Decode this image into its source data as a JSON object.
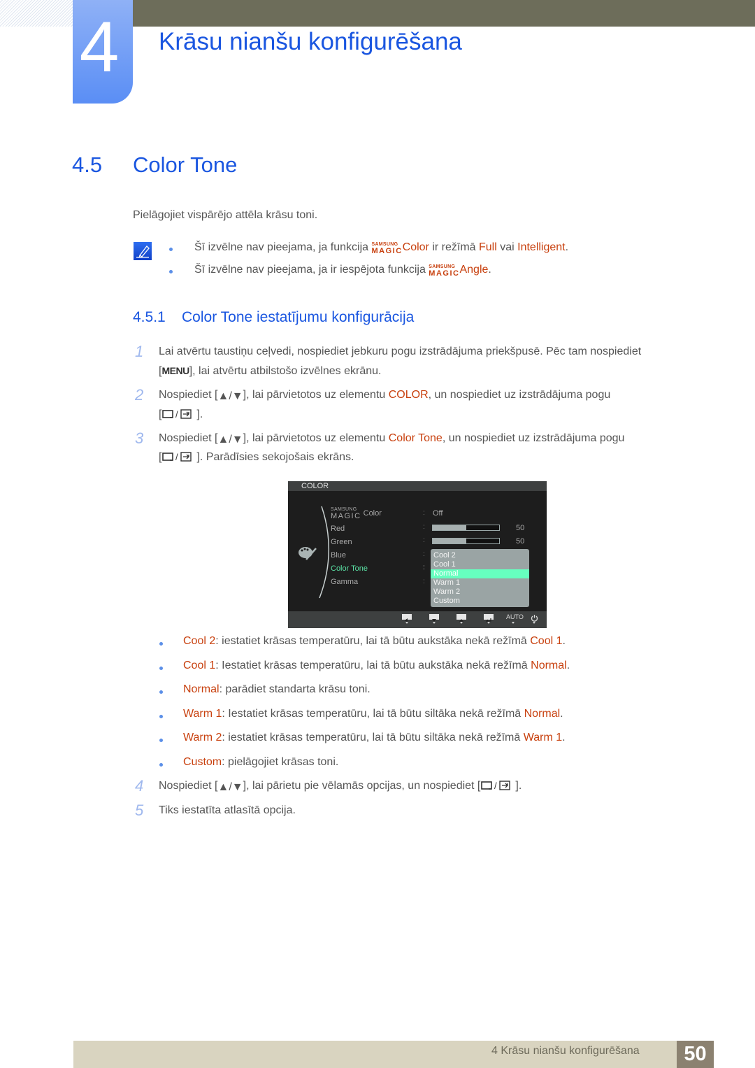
{
  "header": {
    "chapter_number": "4",
    "chapter_title": "Krāsu nianšu konfigurēšana"
  },
  "section": {
    "number": "4.5",
    "title": "Color Tone",
    "intro": "Pielāgojiet vispārējo attēla krāsu toni."
  },
  "notes": {
    "icon": "note-pencil-icon",
    "items": [
      {
        "pre": "Šī izvēlne nav pieejama, ja funkcija ",
        "magic_top": "SAMSUNG",
        "magic_bottom": "MAGIC",
        "magic_word": "Color",
        "mid": " ir režīmā ",
        "hl1": "Full",
        "mid2": " vai ",
        "hl2": "Intelligent",
        "post": "."
      },
      {
        "pre": "Šī izvēlne nav pieejama, ja ir iespējota funkcija ",
        "magic_top": "SAMSUNG",
        "magic_bottom": "MAGIC",
        "magic_word": "Angle",
        "post": "."
      }
    ]
  },
  "subsection": {
    "number": "4.5.1",
    "title": "Color Tone iestatījumu konfigurācija"
  },
  "steps": [
    {
      "num": "1",
      "line1": "Lai atvērtu taustiņu ceļvedi, nospiediet jebkuru pogu izstrādājuma priekšpusē. Pēc tam nospiediet",
      "key": "MENU",
      "line2": "], lai atvērtu atbilstošo izvēlnes ekrānu."
    },
    {
      "num": "2",
      "pre": "Nospiediet [",
      "mid": "], lai pārvietotos uz elementu ",
      "hl": "COLOR",
      "post": ", un nospiediet uz izstrādājuma pogu",
      "line2": "]."
    },
    {
      "num": "3",
      "pre": "Nospiediet [",
      "mid": "], lai pārvietotos uz elementu ",
      "hl": "Color Tone",
      "post": ", un nospiediet uz izstrādājuma pogu",
      "line2": "]. Parādīsies sekojošais ekrāns."
    },
    {
      "num": "4",
      "pre": "Nospiediet [",
      "mid": "], lai pārietu pie vēlamās opcijas, un nospiediet [",
      "post": "]."
    },
    {
      "num": "5",
      "text": "Tiks iestatīta atlasītā opcija."
    }
  ],
  "osd": {
    "header": "COLOR",
    "magic_top": "SAMSUNG",
    "magic_bottom": "MAGIC",
    "items": [
      {
        "label": "Color",
        "value": "Off"
      },
      {
        "label": "Red",
        "bar_percent": 50,
        "value": "50"
      },
      {
        "label": "Green",
        "bar_percent": 50,
        "value": "50"
      },
      {
        "label": "Blue"
      },
      {
        "label": "Color Tone",
        "active": true
      },
      {
        "label": "Gamma"
      }
    ],
    "dropdown_options": [
      "Cool 2",
      "Cool 1",
      "Normal",
      "Warm 1",
      "Warm 2",
      "Custom"
    ],
    "selected_option": "Normal",
    "footer_buttons": [
      "left-arrow",
      "down-arrow",
      "up-arrow",
      "enter",
      "AUTO",
      "power"
    ],
    "auto_label": "AUTO",
    "active_color": "#5be2a5",
    "selected_bg": "#66ffbf"
  },
  "options": [
    {
      "name": "Cool 2",
      "text": ": iestatiet krāsas temperatūru, lai tā būtu aukstāka nekā režīmā ",
      "ref": "Cool 1",
      "end": "."
    },
    {
      "name": "Cool 1",
      "text": ": Iestatiet krāsas temperatūru, lai tā būtu aukstāka nekā režīmā ",
      "ref": "Normal",
      "end": "."
    },
    {
      "name": "Normal",
      "text": ": parādiet standarta krāsu toni.",
      "ref": "",
      "end": ""
    },
    {
      "name": "Warm 1",
      "text": ": Iestatiet krāsas temperatūru, lai tā būtu siltāka nekā režīmā ",
      "ref": "Normal",
      "end": "."
    },
    {
      "name": "Warm 2",
      "text": ": iestatiet krāsas temperatūru, lai tā būtu siltāka nekā režīmā ",
      "ref": "Warm 1",
      "end": "."
    },
    {
      "name": "Custom",
      "text": ": pielāgojiet krāsas toni.",
      "ref": "",
      "end": ""
    }
  ],
  "footer": {
    "text": "4 Krāsu nianšu konfigurēšana",
    "page": "50"
  },
  "colors": {
    "heading_blue": "#1a56e0",
    "highlight_orange": "#c8400e",
    "top_bar": "#6d6d5a",
    "footer_bar": "#d9d4c0",
    "page_box": "#8b8170"
  }
}
